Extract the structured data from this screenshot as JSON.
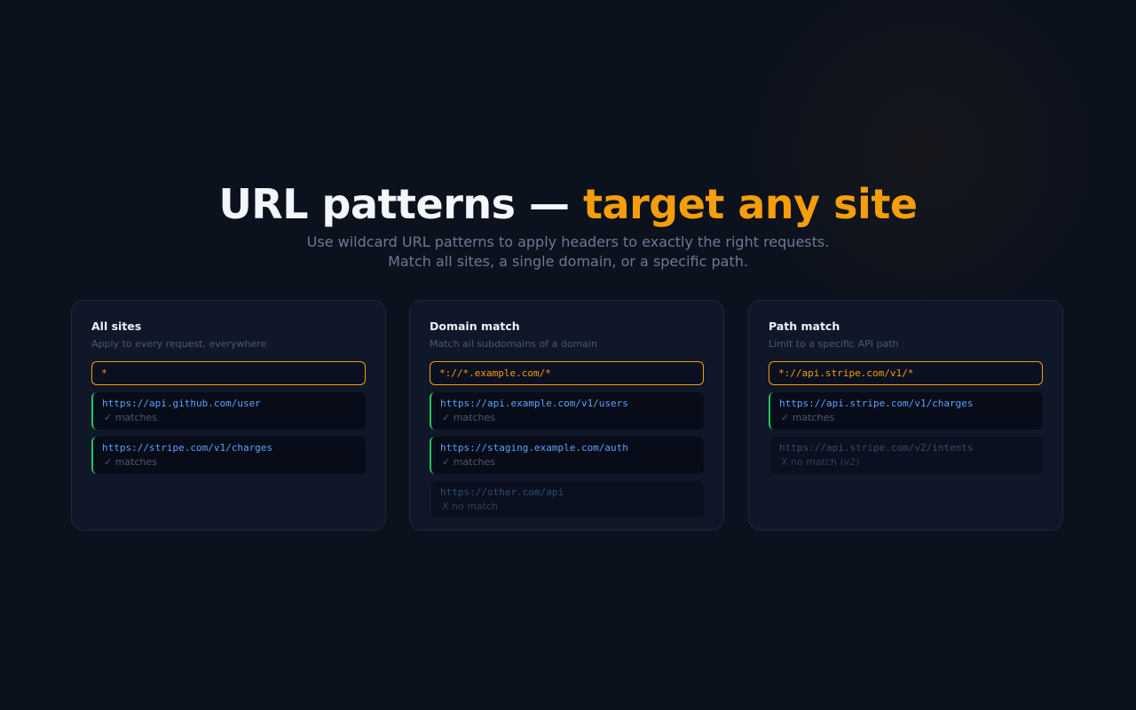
{
  "hero": {
    "title_main": "URL patterns — ",
    "title_accent": "target any site",
    "subtitle_line1": "Use wildcard URL patterns to apply headers to exactly the right requests.",
    "subtitle_line2": "Match all sites, a single domain, or a specific path."
  },
  "colors": {
    "background": "#0b111d",
    "accent": "#f59e0b",
    "match": "#22c55e",
    "url": "#5aa2ff"
  },
  "cards": [
    {
      "title": "All sites",
      "description": "Apply to every request, everywhere",
      "pattern": "*",
      "examples": [
        {
          "url": "https://api.github.com/user",
          "status": "✓ matches"
        },
        {
          "url": "https://stripe.com/v1/charges",
          "status": "✓ matches"
        }
      ]
    },
    {
      "title": "Domain match",
      "description": "Match all subdomains of a domain",
      "pattern": "*://*.example.com/*",
      "examples": [
        {
          "url": "https://api.example.com/v1/users",
          "status": "✓ matches"
        },
        {
          "url": "https://staging.example.com/auth",
          "status": "✓ matches"
        },
        {
          "url": "https://other.com/api",
          "status": "X no match"
        }
      ]
    },
    {
      "title": "Path match",
      "description": "Limit to a specific API path",
      "pattern": "*://api.stripe.com/v1/*",
      "examples": [
        {
          "url": "https://api.stripe.com/v1/charges",
          "status": "✓ matches"
        },
        {
          "url": "https://api.stripe.com/v2/intents",
          "status": "X no match (v2)"
        }
      ]
    }
  ]
}
